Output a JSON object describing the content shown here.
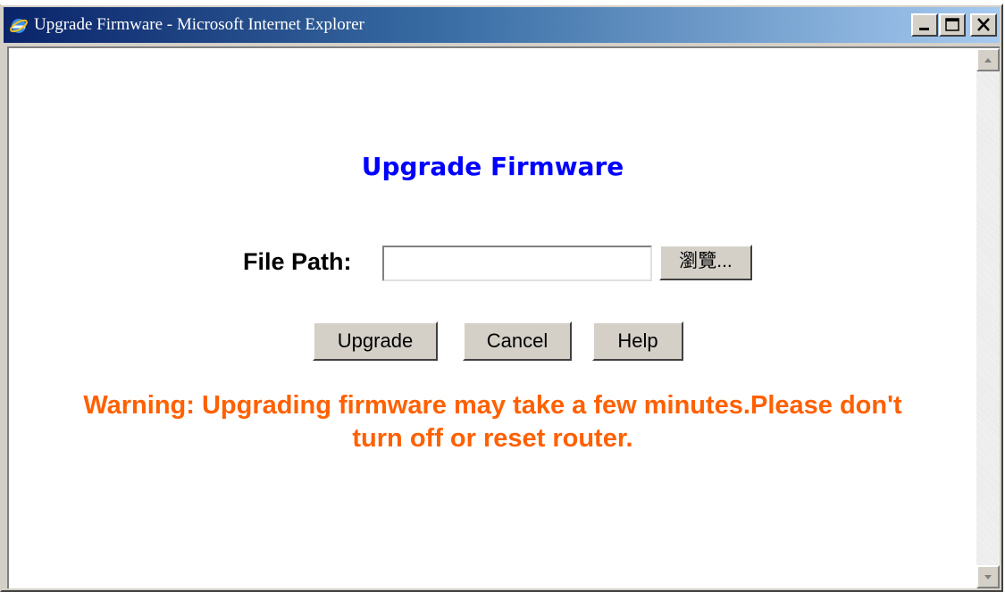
{
  "window": {
    "title": "Upgrade Firmware - Microsoft Internet Explorer"
  },
  "page": {
    "heading": "Upgrade Firmware",
    "file_path_label": "File Path:",
    "file_path_value": "",
    "browse_label": "瀏覽...",
    "buttons": {
      "upgrade": "Upgrade",
      "cancel": "Cancel",
      "help": "Help"
    },
    "warning_line1": "Warning: Upgrading firmware may take a few minutes.Please don't",
    "warning_line2": "turn off or reset router."
  },
  "colors": {
    "heading": "#0000ff",
    "warning": "#ff6000",
    "titlebar_start": "#0a246a",
    "titlebar_end": "#a6caf0",
    "button_face": "#d4d0c8"
  },
  "icons": {
    "app": "internet-explorer-icon",
    "minimize": "minimize-icon",
    "maximize": "maximize-icon",
    "close": "close-icon",
    "scroll_up": "scroll-up-arrow-icon",
    "scroll_down": "scroll-down-arrow-icon"
  }
}
